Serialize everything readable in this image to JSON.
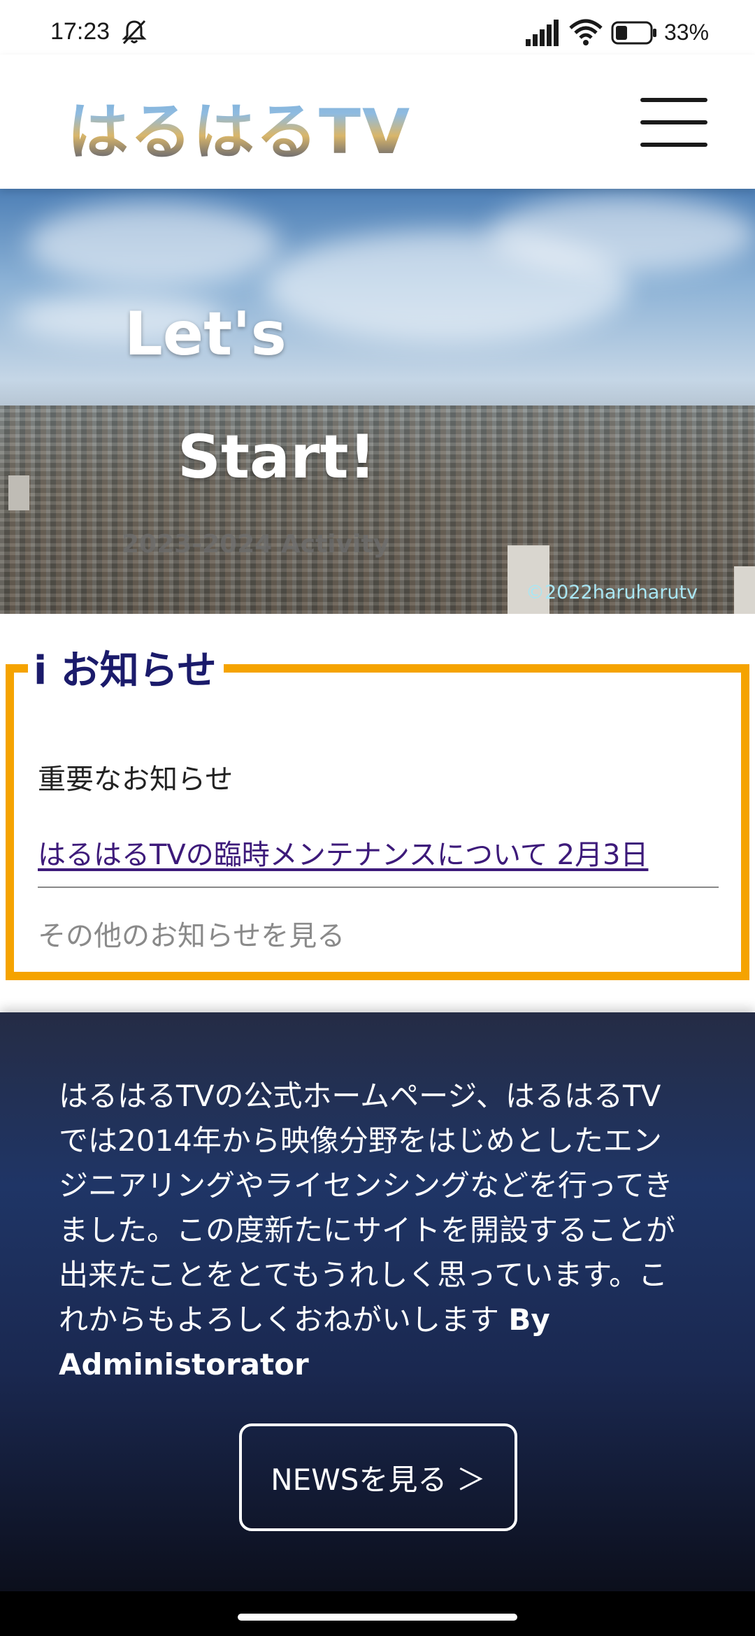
{
  "status_bar": {
    "time": "17:23",
    "battery": "33%",
    "icons": [
      "bell-off-icon",
      "signal-icon",
      "wifi-icon",
      "battery-icon"
    ]
  },
  "header": {
    "logo": "はるはるTV",
    "menu_icon": "hamburger-menu-icon"
  },
  "hero": {
    "line1": "Let's",
    "line2": "Start!",
    "activity": "2023-2024 Activity",
    "copyright": "©2022haruharutv"
  },
  "notice": {
    "heading": "i お知らせ",
    "important_label": "重要なお知らせ",
    "link_text": "はるはるTVの臨時メンテナンスについて 2月3日",
    "more_link": "その他のお知らせを見る",
    "border_color": "#f5a300"
  },
  "about": {
    "text": "はるはるTVの公式ホームページ、はるはるTVでは2014年から映像分野をはじめとしたエンジニアリングやライセンシングなどを行ってきました。この度新たにサイトを開設することが出来たことをとてもうれしく思っています。これからもよろしくおねがいします",
    "signature": "By Administorator",
    "button_label": "NEWSを見る ＞"
  }
}
